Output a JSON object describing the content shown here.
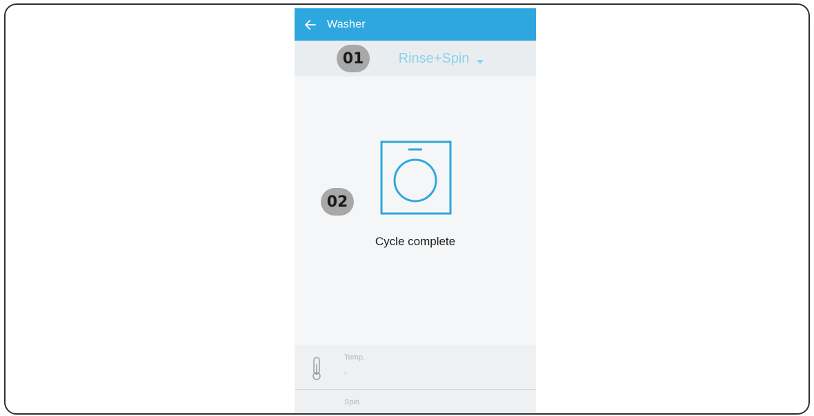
{
  "app_bar": {
    "title": "Washer",
    "back_icon": "arrow-left-icon"
  },
  "program_bar": {
    "selected_program": "Rinse+Spin",
    "dropdown_icon": "caret-down-icon"
  },
  "callouts": {
    "first": "01",
    "second": "02"
  },
  "status": {
    "icon": "washing-machine-icon",
    "text": "Cycle complete"
  },
  "info_panel": {
    "items": [
      {
        "label": "Temp.",
        "value": "-",
        "icon": "thermometer-icon"
      },
      {
        "label": "Spin",
        "value": "",
        "icon": "spin-dial-icon"
      }
    ]
  },
  "colors": {
    "accent": "#2ea7df",
    "program_text": "#8fd0ee",
    "callout_badge": "#a8a8a8"
  }
}
